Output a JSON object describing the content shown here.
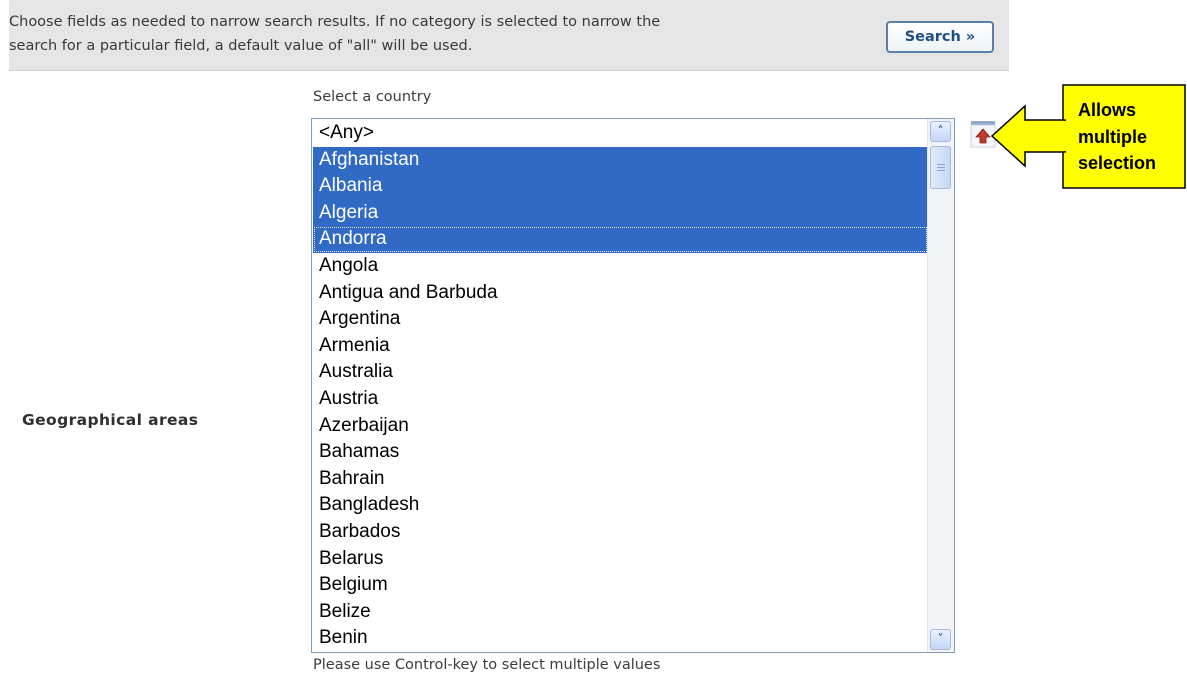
{
  "header": {
    "instructions": "Choose fields as needed to narrow search results. If no category is selected to narrow the\nsearch for a particular field, a default value of \"all\" will be used.",
    "search_button": "Search »"
  },
  "field": {
    "label": "Geographical areas",
    "select_label": "Select a country",
    "help": "Please use Control-key to select multiple values"
  },
  "countries": [
    {
      "name": "<Any>",
      "selected": false
    },
    {
      "name": "Afghanistan",
      "selected": true
    },
    {
      "name": "Albania",
      "selected": true
    },
    {
      "name": "Algeria",
      "selected": true
    },
    {
      "name": "Andorra",
      "selected": true,
      "focused": true
    },
    {
      "name": "Angola",
      "selected": false
    },
    {
      "name": "Antigua and Barbuda",
      "selected": false
    },
    {
      "name": "Argentina",
      "selected": false
    },
    {
      "name": "Armenia",
      "selected": false
    },
    {
      "name": "Australia",
      "selected": false
    },
    {
      "name": "Austria",
      "selected": false
    },
    {
      "name": "Azerbaijan",
      "selected": false
    },
    {
      "name": "Bahamas",
      "selected": false
    },
    {
      "name": "Bahrain",
      "selected": false
    },
    {
      "name": "Bangladesh",
      "selected": false
    },
    {
      "name": "Barbados",
      "selected": false
    },
    {
      "name": "Belarus",
      "selected": false
    },
    {
      "name": "Belgium",
      "selected": false
    },
    {
      "name": "Belize",
      "selected": false
    },
    {
      "name": "Benin",
      "selected": false
    }
  ],
  "icons": {
    "collapse": "collapse-arrow-icon",
    "scroll_up": "chevron-up-icon",
    "scroll_down": "chevron-down-icon"
  },
  "annotation": {
    "text": "Allows\nmultiple\nselection",
    "color": "#ffff00"
  },
  "colors": {
    "selection": "#316ac5",
    "header_bg": "#e5e5e5",
    "button_text": "#1f4f82",
    "callout_fill": "#ffff00"
  }
}
